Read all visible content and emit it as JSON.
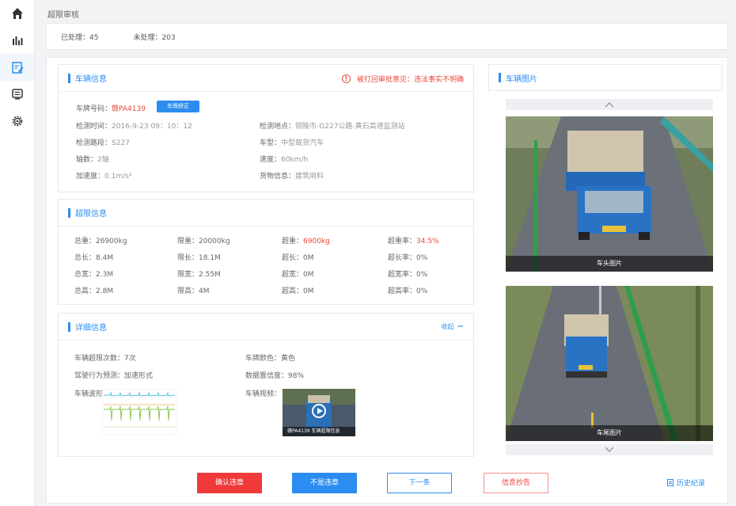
{
  "page": {
    "title": "超限审核"
  },
  "sidebar": {
    "items": [
      {
        "icon": "home-icon",
        "active": false
      },
      {
        "icon": "bar-chart-icon",
        "active": false
      },
      {
        "icon": "edit-document-icon",
        "active": true
      },
      {
        "icon": "monitor-icon",
        "active": false
      },
      {
        "icon": "settings-icon",
        "active": false
      }
    ]
  },
  "stats": {
    "processed": "已处理：45",
    "unprocessed": "未处理：203"
  },
  "vehicle": {
    "title": "车辆信息",
    "rejected_notice": "被打回审批意见：违法事实不明确",
    "plate_label": "车牌号码：",
    "plate_value": "赣PA4139",
    "plate_button": "车牌矫正",
    "fields": [
      {
        "label": "检测时间：",
        "value": "2016-9-23  09：10：12"
      },
      {
        "label": "检测地点：",
        "value": "铜陵市-G227公路-黄石高速监测站"
      },
      {
        "label": "检测路段：",
        "value": "S227"
      },
      {
        "label": "车型：",
        "value": "中型载货汽车"
      },
      {
        "label": "轴数：",
        "value": "2轴"
      },
      {
        "label": "速度：",
        "value": "60km/h"
      },
      {
        "label": "加速度：",
        "value": "0.1m/s²"
      },
      {
        "label": "货物信息：",
        "value": "建筑用料"
      }
    ]
  },
  "overlimit": {
    "title": "超限信息",
    "rows": [
      [
        "总重：26900kg",
        "限重：20000kg",
        "超重：",
        "6900kg",
        "超重率：",
        "34.5%"
      ],
      [
        "总长：8.4M",
        "限长：18.1M",
        "超长：",
        "0M",
        "超长率：",
        "0%"
      ],
      [
        "总宽：2.3M",
        "限宽：2.55M",
        "超宽：",
        "0M",
        "超宽率：",
        "0%"
      ],
      [
        "总高：2.8M",
        "限高：4M",
        "超高：",
        "0M",
        "超高率：",
        "0%"
      ]
    ]
  },
  "detail": {
    "title": "详细信息",
    "collapse": "收起",
    "overlimit_count": "车辆超限次数：7次",
    "plate_color": "车牌颜色：黄色",
    "behavior": "驾驶行为预测：加速形式",
    "confidence": "数据置信度：98%",
    "waveform_label": "车辆波形：",
    "video_label": "车辆视频：",
    "video_caption": "赣PA4139 车辆超限信息"
  },
  "photos": {
    "title": "车辆图片",
    "front_caption": "车头图片",
    "rear_caption": "车尾图片",
    "scroll_up_icon": "chevron-up-icon",
    "scroll_down_icon": "chevron-down-icon"
  },
  "actions": {
    "confirm": "确认违章",
    "not_violation": "不是违章",
    "next": "下一条",
    "info_error": "信息抄告",
    "history": "历史纪录"
  },
  "colors": {
    "accent": "#2d8cf0",
    "danger": "#f03a3a"
  }
}
